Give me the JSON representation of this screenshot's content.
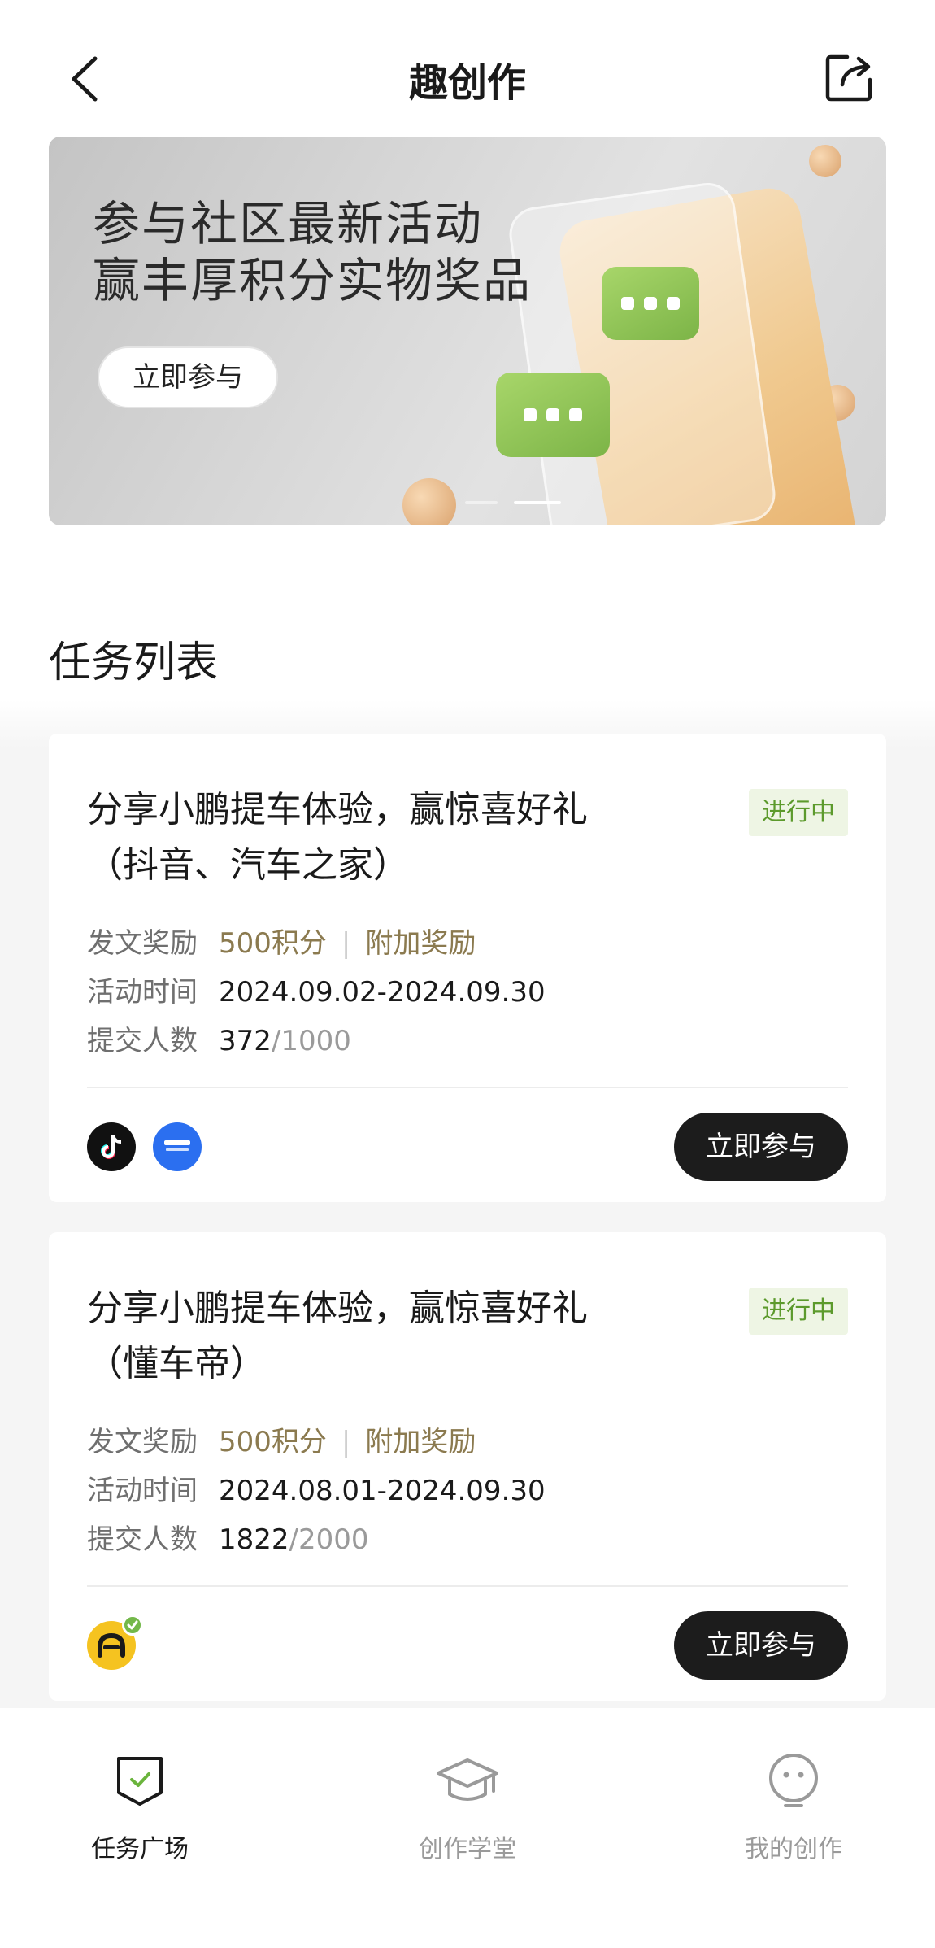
{
  "header": {
    "title": "趣创作"
  },
  "banner": {
    "line1": "参与社区最新活动",
    "line2": "赢丰厚积分实物奖品",
    "button": "立即参与",
    "colors": {
      "bubble": "#8cc554",
      "phone": "#f0c98f"
    }
  },
  "section": {
    "title": "任务列表"
  },
  "tasks": [
    {
      "title_line1": "分享小鹏提车体验，赢惊喜好礼",
      "title_line2": "（抖音、汽车之家）",
      "status": "进行中",
      "reward_label": "发文奖励",
      "reward_points": "500积分",
      "reward_sep": "|",
      "reward_extra": "附加奖励",
      "time_label": "活动时间",
      "time_value": "2024.09.02-2024.09.30",
      "count_label": "提交人数",
      "count_value": "372",
      "count_total": "/1000",
      "platforms": [
        "douyin-icon",
        "autohome-icon"
      ],
      "button": "立即参与"
    },
    {
      "title_line1": "分享小鹏提车体验，赢惊喜好礼",
      "title_line2": "（懂车帝）",
      "status": "进行中",
      "reward_label": "发文奖励",
      "reward_points": "500积分",
      "reward_sep": "|",
      "reward_extra": "附加奖励",
      "time_label": "活动时间",
      "time_value": "2024.08.01-2024.09.30",
      "count_label": "提交人数",
      "count_value": "1822",
      "count_total": "/2000",
      "platforms": [
        "dongchedi-icon"
      ],
      "button": "立即参与"
    }
  ],
  "nav": [
    {
      "label": "任务广场",
      "icon": "shield-check-icon",
      "active": true
    },
    {
      "label": "创作学堂",
      "icon": "graduation-cap-icon",
      "active": false
    },
    {
      "label": "我的创作",
      "icon": "smile-face-icon",
      "active": false
    }
  ],
  "colors": {
    "status_bg": "#eef5e4",
    "status_text": "#5c9a2c",
    "reward_gold": "#8b7a4f",
    "button_dark": "#1c1c1c"
  }
}
